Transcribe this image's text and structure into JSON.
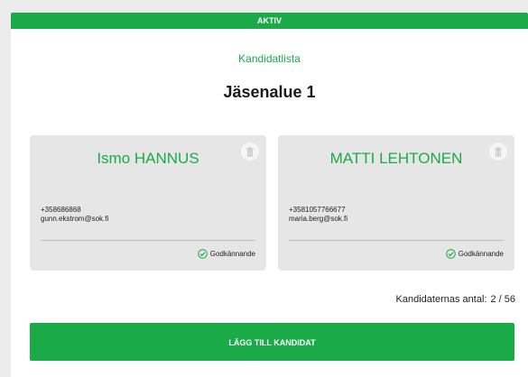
{
  "status": {
    "label": "AKTIV"
  },
  "header": {
    "list_label": "Kandidatlista",
    "title": "Jäsenalue 1"
  },
  "candidates": [
    {
      "name": "Ismo HANNUS",
      "phone": "+358686868",
      "email": "gunn.ekstrom@sok.fi",
      "approval_label": "Godkännande"
    },
    {
      "name": "MATTI LEHTONEN",
      "phone": "+3581057766677",
      "email": "maria.berg@sok.fi",
      "approval_label": "Godkännande"
    }
  ],
  "count": {
    "label": "Kandidaternas antal:",
    "value": "2 / 56"
  },
  "actions": {
    "add_label": "LÄGG TILL KANDIDAT"
  },
  "colors": {
    "accent": "#1aab48",
    "card_bg": "#e6e6e6",
    "page_bg": "#ececec"
  },
  "icons": {
    "delete": "trash-icon",
    "approval": "check-circle-icon"
  }
}
